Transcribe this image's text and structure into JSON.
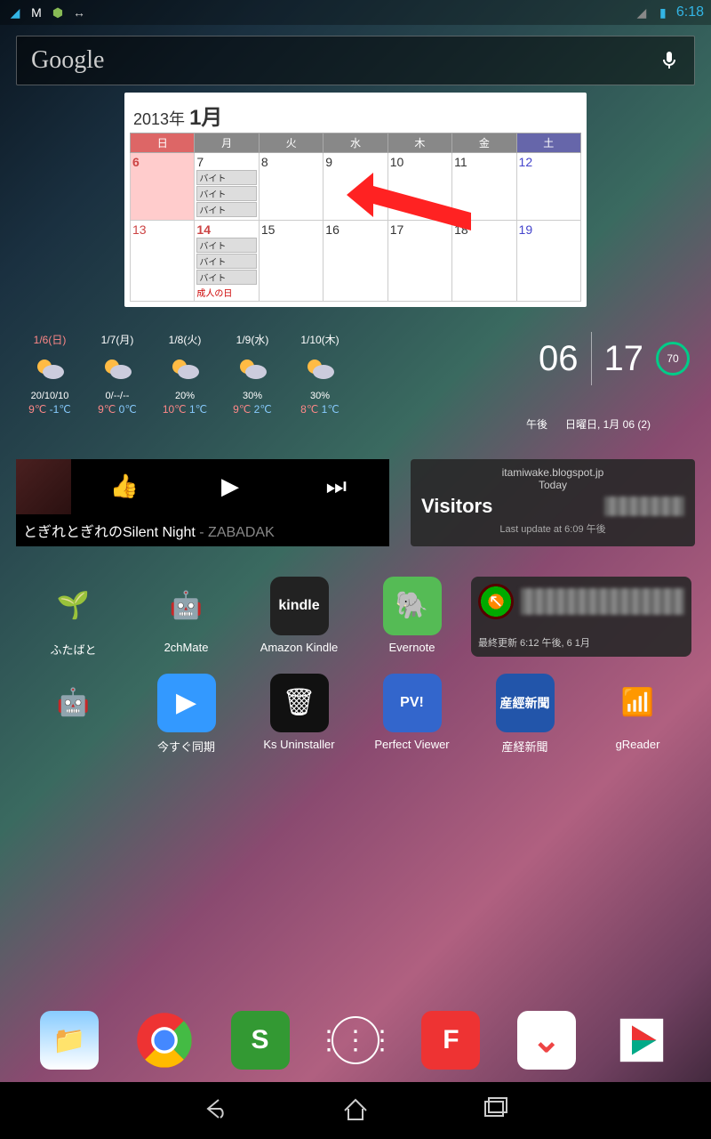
{
  "status": {
    "time": "6:18"
  },
  "search": {
    "label": "Google"
  },
  "calendar": {
    "title_year": "2013年",
    "title_month": "1月",
    "dow": [
      "日",
      "月",
      "火",
      "水",
      "木",
      "金",
      "土"
    ],
    "weeks": [
      [
        {
          "n": "6",
          "cls": "today sun"
        },
        {
          "n": "7",
          "ev": [
            "バイト",
            "バイト",
            "バイト"
          ]
        },
        {
          "n": "8"
        },
        {
          "n": "9"
        },
        {
          "n": "10"
        },
        {
          "n": "11"
        },
        {
          "n": "12",
          "cls": "sat"
        }
      ],
      [
        {
          "n": "13",
          "cls": "sun"
        },
        {
          "n": "14",
          "cls": "hol",
          "ev": [
            "バイト",
            "バイト",
            "バイト"
          ],
          "hol": "成人の日"
        },
        {
          "n": "15"
        },
        {
          "n": "16"
        },
        {
          "n": "17"
        },
        {
          "n": "18"
        },
        {
          "n": "19",
          "cls": "sat"
        }
      ]
    ]
  },
  "weather": [
    {
      "d": "1/6(日)",
      "p": "20/10/10",
      "hi": "9℃",
      "lo": "-1℃",
      "sun": true
    },
    {
      "d": "1/7(月)",
      "p": "0/--/--",
      "hi": "9℃",
      "lo": "0℃"
    },
    {
      "d": "1/8(火)",
      "p": "20%",
      "hi": "10℃",
      "lo": "1℃"
    },
    {
      "d": "1/9(水)",
      "p": "30%",
      "hi": "9℃",
      "lo": "2℃"
    },
    {
      "d": "1/10(木)",
      "p": "30%",
      "hi": "8℃",
      "lo": "1℃"
    }
  ],
  "clock": {
    "h": "06",
    "m": "17",
    "ampm": "午後",
    "date": "日曜日, 1月 06 (2)",
    "batt": "70"
  },
  "music": {
    "title": "とぎれとぎれのSilent Night",
    "sep": " - ",
    "artist": "ZABADAK"
  },
  "visitors": {
    "site": "itamiwake.blogspot.jp",
    "day": "Today",
    "label": "Visitors",
    "foot": "Last update at 6:09 午後"
  },
  "miniwidget": {
    "foot": "最終更新 6:12 午後, 6 1月"
  },
  "apps_row1": [
    {
      "name": "ふたばと",
      "bg": "transparent",
      "glyph": "🌱"
    },
    {
      "name": "2chMate",
      "bg": "transparent",
      "glyph": "🤖"
    },
    {
      "name": "Amazon Kindle",
      "bg": "#222",
      "glyph": "kindle",
      "txt": true
    },
    {
      "name": "Evernote",
      "bg": "#5b5",
      "glyph": "🐘"
    }
  ],
  "apps_row2": [
    {
      "name": "",
      "bg": "transparent",
      "glyph": "🤖",
      "nolabel": true
    },
    {
      "name": "今すぐ同期",
      "bg": "#39f",
      "glyph": "▶"
    },
    {
      "name": "Ks Uninstaller",
      "bg": "#111",
      "glyph": "🗑"
    },
    {
      "name": "Perfect Viewer",
      "bg": "#36c",
      "glyph": "PV!",
      "txt": true
    },
    {
      "name": "産経新聞",
      "bg": "#25a",
      "glyph": "産經新聞",
      "txt": true,
      "small": true
    },
    {
      "name": "gReader",
      "bg": "transparent",
      "glyph": "📶"
    }
  ],
  "dock": [
    {
      "name": "es-file",
      "bg": "linear-gradient(#8cf,#fff)",
      "glyph": "📁"
    },
    {
      "name": "chrome",
      "bg": "#fff",
      "glyph": "◉"
    },
    {
      "name": "app-s",
      "bg": "#393",
      "glyph": "S"
    },
    {
      "name": "apps",
      "bg": "transparent",
      "glyph": "apps"
    },
    {
      "name": "flipboard",
      "bg": "#e33",
      "glyph": "F"
    },
    {
      "name": "pocket",
      "bg": "#fff",
      "glyph": "◡"
    },
    {
      "name": "play",
      "bg": "#fff",
      "glyph": "▶"
    }
  ]
}
